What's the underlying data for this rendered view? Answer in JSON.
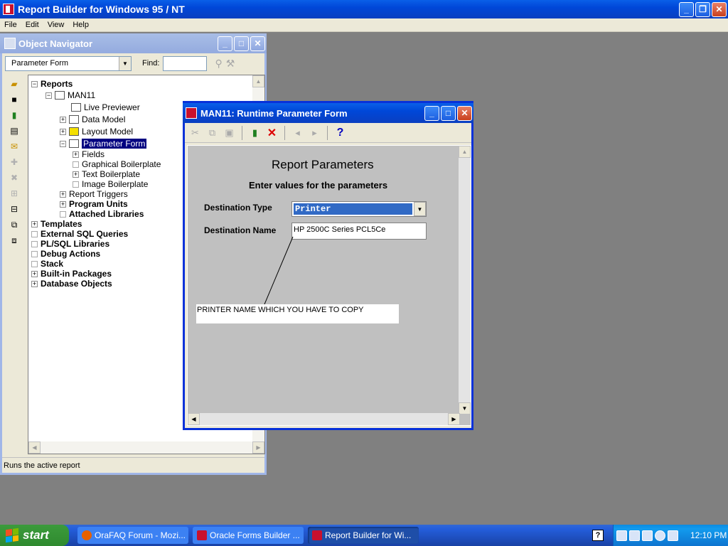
{
  "app": {
    "title": "Report Builder for Windows 95 / NT",
    "menu": [
      "File",
      "Edit",
      "View",
      "Help"
    ]
  },
  "navigator": {
    "title": "Object Navigator",
    "combo_value": "Parameter Form",
    "find_label": "Find:",
    "find_value": "",
    "tree": {
      "reports": "Reports",
      "man11": "MAN11",
      "live_previewer": "Live Previewer",
      "data_model": "Data Model",
      "layout_model": "Layout Model",
      "parameter_form": "Parameter Form",
      "fields": "Fields",
      "graphical_boilerplate": "Graphical Boilerplate",
      "text_boilerplate": "Text Boilerplate",
      "image_boilerplate": "Image Boilerplate",
      "report_triggers": "Report Triggers",
      "program_units": "Program Units",
      "attached_libraries": "Attached Libraries",
      "templates": "Templates",
      "external_sql_queries": "External SQL Queries",
      "plsql_libraries": "PL/SQL Libraries",
      "debug_actions": "Debug Actions",
      "stack": "Stack",
      "builtin_packages": "Built-in Packages",
      "database_objects": "Database Objects"
    },
    "status": "Runs the active report"
  },
  "runtime_form": {
    "title": "MAN11: Runtime Parameter Form",
    "heading": "Report Parameters",
    "subheading": "Enter values for the parameters",
    "destination_type_label": "Destination Type",
    "destination_type_value": "Printer",
    "destination_name_label": "Destination Name",
    "destination_name_value": "HP 2500C Series PCL5Ce",
    "callout_text": "PRINTER NAME WHICH YOU HAVE TO COPY",
    "help_symbol": "?"
  },
  "taskbar": {
    "start_label": "start",
    "tasks": [
      {
        "label": "OraFAQ Forum - Mozi...",
        "icon": "firefox-icon"
      },
      {
        "label": "Oracle Forms Builder ...",
        "icon": "forms-builder-icon"
      },
      {
        "label": "Report Builder for Wi...",
        "icon": "report-builder-icon",
        "active": true
      }
    ],
    "clock": "12:10 PM"
  },
  "colors": {
    "xp_blue": "#0a5fe8",
    "selection": "#000080",
    "dropdown_selection": "#316ac5",
    "close_red": "#c8401e",
    "start_green": "#3c9b3c"
  }
}
